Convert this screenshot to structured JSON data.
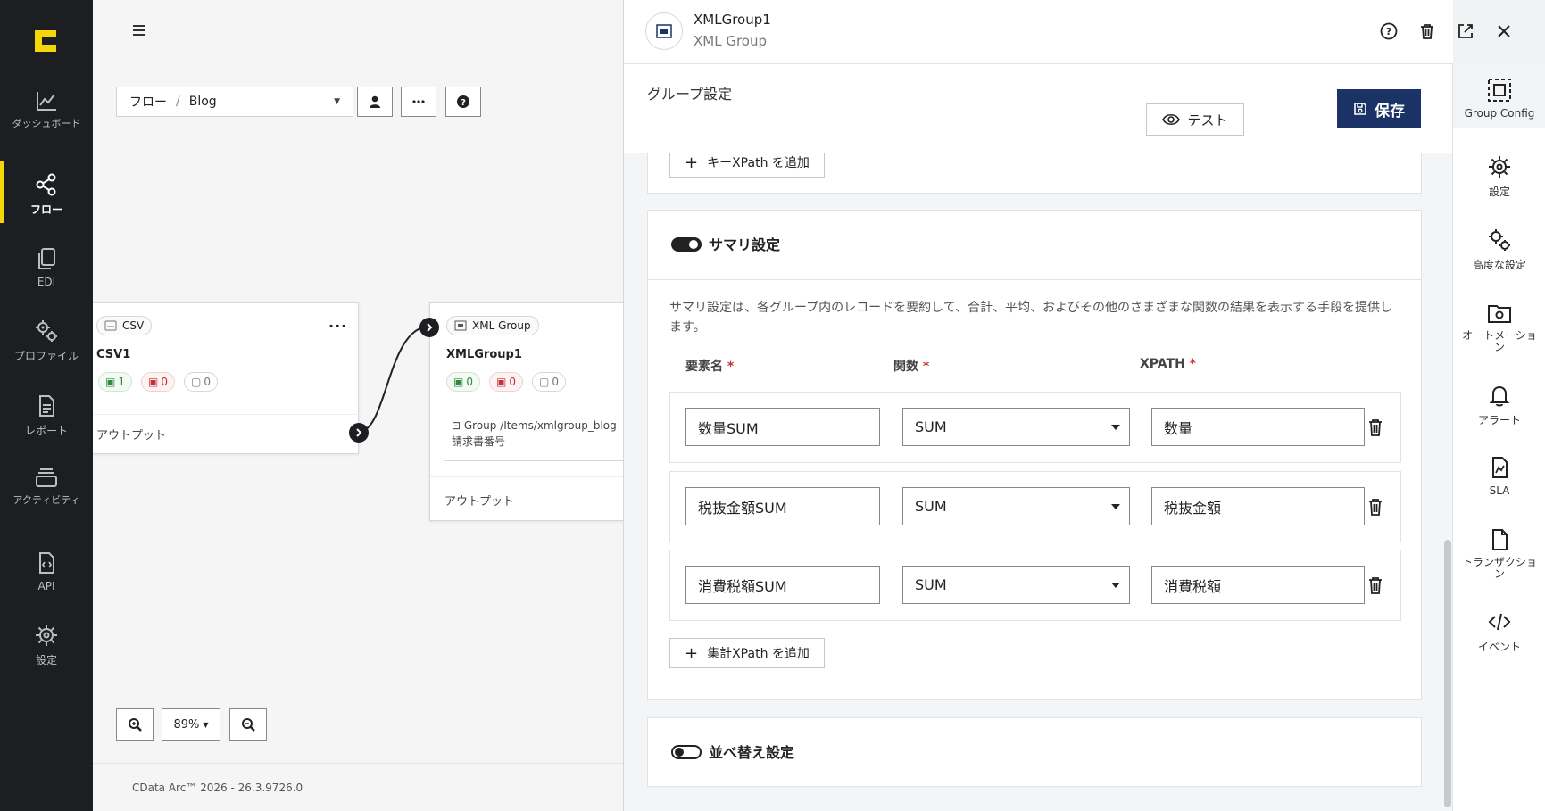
{
  "leftnav": {
    "items": [
      {
        "label": "ダッシュボード",
        "icon": "chart-line-icon"
      },
      {
        "label": "フロー",
        "icon": "share-nodes-icon",
        "active": true
      },
      {
        "label": "EDI",
        "icon": "documents-icon"
      },
      {
        "label": "プロファイル",
        "icon": "gears-icon"
      },
      {
        "label": "レポート",
        "icon": "report-icon"
      },
      {
        "label": "アクティビティ",
        "icon": "stack-icon"
      },
      {
        "label": "API",
        "icon": "api-file-icon"
      },
      {
        "label": "設定",
        "icon": "gear-icon"
      }
    ]
  },
  "canvas": {
    "breadcrumb": {
      "root": "フロー",
      "separator": "/",
      "current": "Blog"
    },
    "nodes": {
      "csv": {
        "tag": "CSV",
        "title": "CSV1",
        "counts": [
          "1",
          "0",
          "0"
        ],
        "output": "アウトプット",
        "menu": "..."
      },
      "xml": {
        "tag": "XML Group",
        "title": "XMLGroup1",
        "counts": [
          "0",
          "0",
          "0"
        ],
        "group_path": "Group /Items/xmlgroup_blog",
        "group_key": "請求書番号",
        "output": "アウトプット"
      }
    },
    "zoom": "89%",
    "footer": "CData Arc™ 2026 - 26.3.9726.0"
  },
  "panel": {
    "title": "XMLGroup1",
    "subtitle": "XML Group",
    "section_title": "グループ設定",
    "test_label": "テスト",
    "save_label": "保存",
    "key_add_label": "キーXPath を追加",
    "summary": {
      "title": "サマリ設定",
      "enabled": true,
      "description": "サマリ設定は、各グループ内のレコードを要約して、合計、平均、およびその他のさまざまな関数の結果を表示する手段を提供します。",
      "col_name": "要素名",
      "col_func": "関数",
      "col_xpath": "XPATH",
      "required_mark": "*",
      "rows": [
        {
          "name": "数量SUM",
          "func": "SUM",
          "xpath": "数量"
        },
        {
          "name": "税抜金額SUM",
          "func": "SUM",
          "xpath": "税抜金額"
        },
        {
          "name": "消費税額SUM",
          "func": "SUM",
          "xpath": "消費税額"
        }
      ],
      "add_label": "集計XPath を追加"
    },
    "sort": {
      "title": "並べ替え設定",
      "enabled": false
    }
  },
  "rail": {
    "items": [
      {
        "label": "Group Config",
        "icon": "group-config-icon",
        "active": true
      },
      {
        "label": "設定",
        "icon": "gear-icon"
      },
      {
        "label": "高度な設定",
        "icon": "gears-icon"
      },
      {
        "label": "オートメーション",
        "icon": "automation-folder-icon"
      },
      {
        "label": "アラート",
        "icon": "bell-icon"
      },
      {
        "label": "SLA",
        "icon": "sla-file-icon"
      },
      {
        "label": "トランザクション",
        "icon": "file-icon"
      },
      {
        "label": "イベント",
        "icon": "code-icon"
      }
    ]
  }
}
